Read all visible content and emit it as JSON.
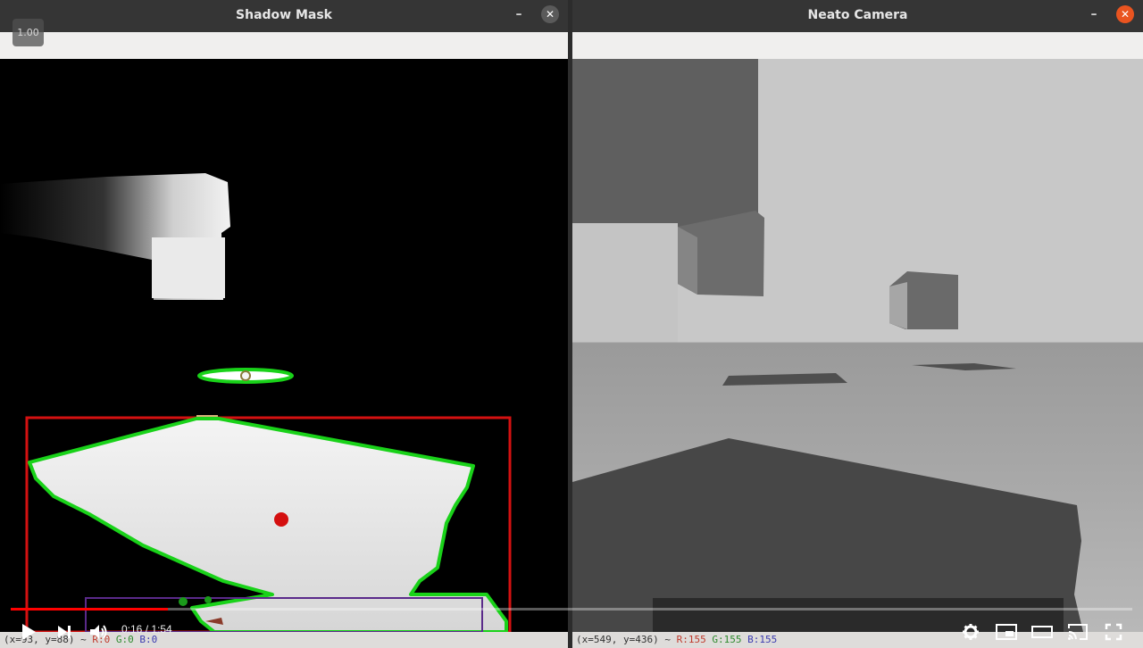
{
  "left_window": {
    "title": "Shadow Mask",
    "minimize_glyph": "–",
    "close_glyph": "✕",
    "speed_badge": "1.00",
    "status": {
      "coords": "(x=93, y=88) ~",
      "r": "R:0",
      "g": "G:0",
      "b": "B:0"
    }
  },
  "right_window": {
    "title": "Neato Camera",
    "minimize_glyph": "–",
    "close_glyph": "✕",
    "status": {
      "coords": "(x=549, y=436) ~",
      "r": "R:155",
      "g": "G:155",
      "b": "B:155"
    }
  },
  "player": {
    "time": "0:16 / 1:54",
    "progress_fraction": 0.14,
    "colors": {
      "played": "#ff0000",
      "accent_close": "#e95420"
    },
    "icons": [
      "play-icon",
      "next-icon",
      "volume-icon",
      "settings-icon",
      "miniplayer-icon",
      "theater-icon",
      "cast-icon",
      "fullscreen-icon"
    ]
  }
}
